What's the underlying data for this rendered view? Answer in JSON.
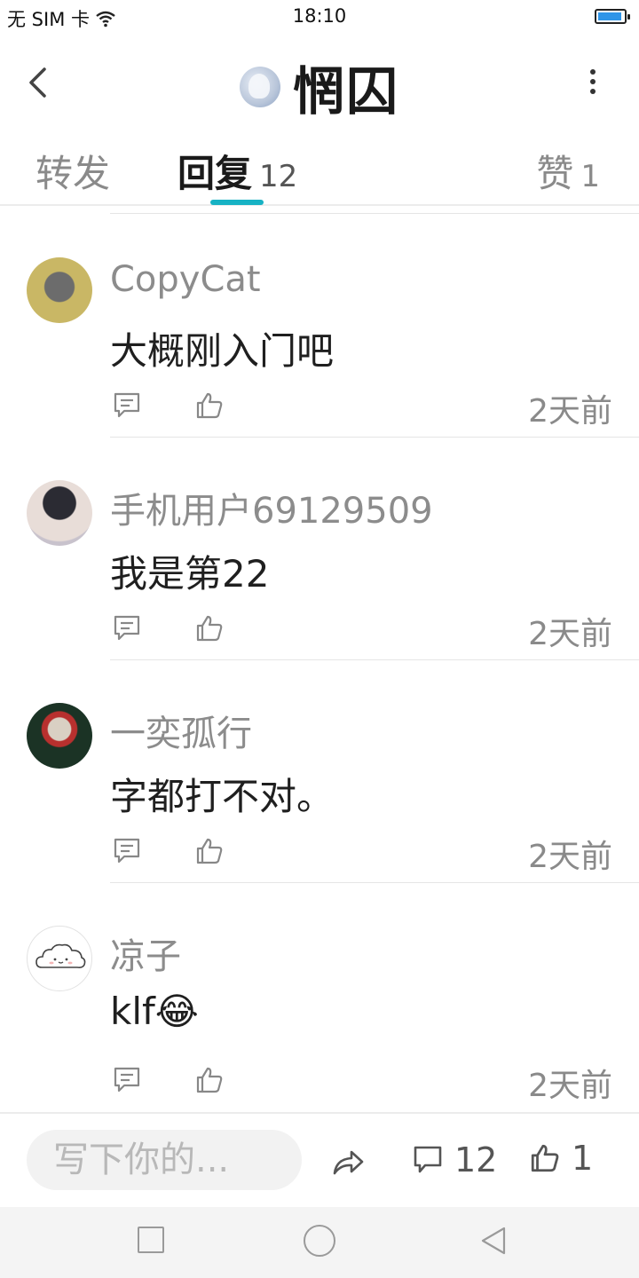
{
  "status_bar": {
    "carrier": "无 SIM 卡",
    "time": "18:10"
  },
  "header": {
    "title": "惘囚",
    "back_icon": "chevron-left-icon",
    "more_icon": "more-vertical-icon"
  },
  "tabs": {
    "forward": {
      "label": "转发"
    },
    "reply": {
      "label": "回复",
      "count": "12"
    },
    "like": {
      "label": "赞",
      "count": "1"
    }
  },
  "comments": [
    {
      "name": "CopyCat",
      "text": "大概刚入门吧",
      "time": "2天前",
      "avatar_color": "#b9a455"
    },
    {
      "name": "手机用户69129509",
      "text": "我是第22",
      "time": "2天前",
      "avatar_color": "#3b3b45"
    },
    {
      "name": "一奕孤行",
      "text": "字都打不对。",
      "time": "2天前",
      "avatar_color": "#1d3a2a"
    },
    {
      "name": "凉子",
      "text": "klf😂",
      "time": "2天前",
      "avatar_color": "#ffffff"
    }
  ],
  "bottom_bar": {
    "compose_placeholder": "写下你的...",
    "comment_count": "12",
    "like_count": "1"
  },
  "colors": {
    "accent": "#17b2c4",
    "battery": "#2f95e8"
  }
}
